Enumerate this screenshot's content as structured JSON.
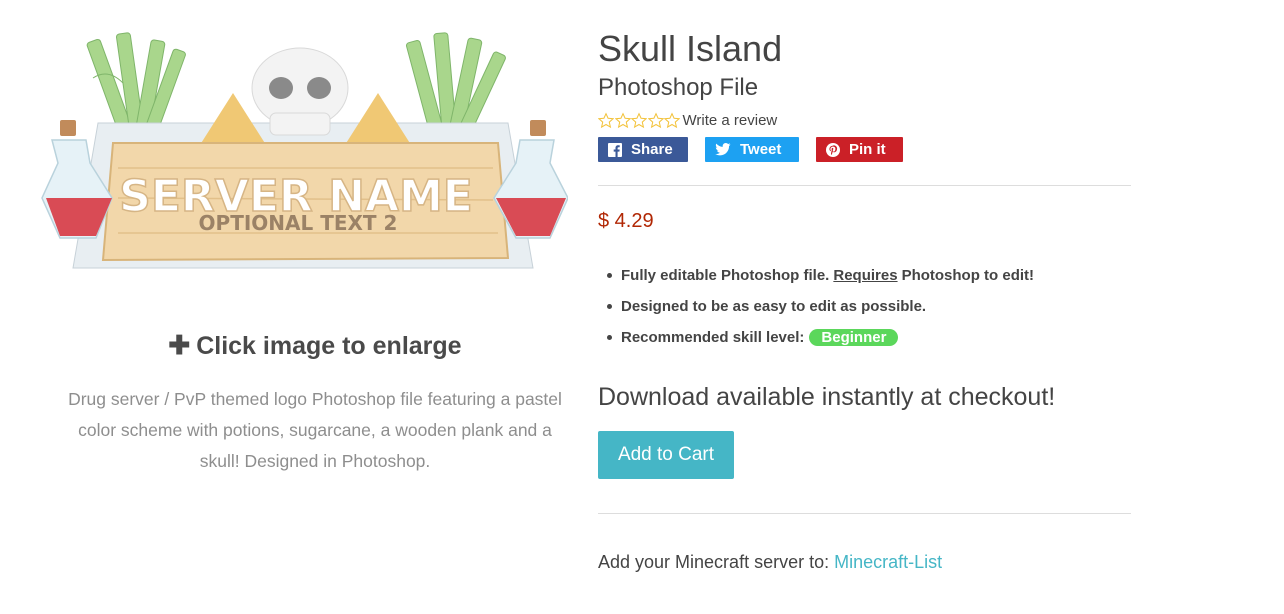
{
  "product": {
    "title": "Skull Island",
    "subtitle": "Photoshop File",
    "price": "$ 4.29",
    "description": "Drug server / PvP themed logo Photoshop file featuring a pastel color scheme with potions, sugarcane, a wooden plank and a skull! Designed in Photoshop."
  },
  "image": {
    "main_text": "SERVER NAME",
    "sub_text": "OPTIONAL TEXT 2",
    "enlarge_label": "Click image to enlarge"
  },
  "rating": {
    "stars": 0,
    "max": 5,
    "review_label": "Write a review"
  },
  "social": {
    "share_label": "Share",
    "tweet_label": "Tweet",
    "pin_label": "Pin it"
  },
  "features": {
    "item1_before": "Fully editable Photoshop file.",
    "item1_link": "Requires",
    "item1_after": "Photoshop to edit!",
    "item2": "Designed to be as easy to edit as possible.",
    "item3": "Recommended skill level:",
    "skill_badge": "Beginner"
  },
  "download_text": "Download available instantly at checkout!",
  "cart_label": "Add to Cart",
  "footer": {
    "prefix": "Add your Minecraft server to:",
    "link": "Minecraft-List"
  },
  "colors": {
    "accent": "#45b6c6",
    "price": "#b12704",
    "badge": "#5bd75b",
    "facebook": "#3b5998",
    "twitter": "#1da1f2",
    "pinterest": "#cb2027"
  }
}
